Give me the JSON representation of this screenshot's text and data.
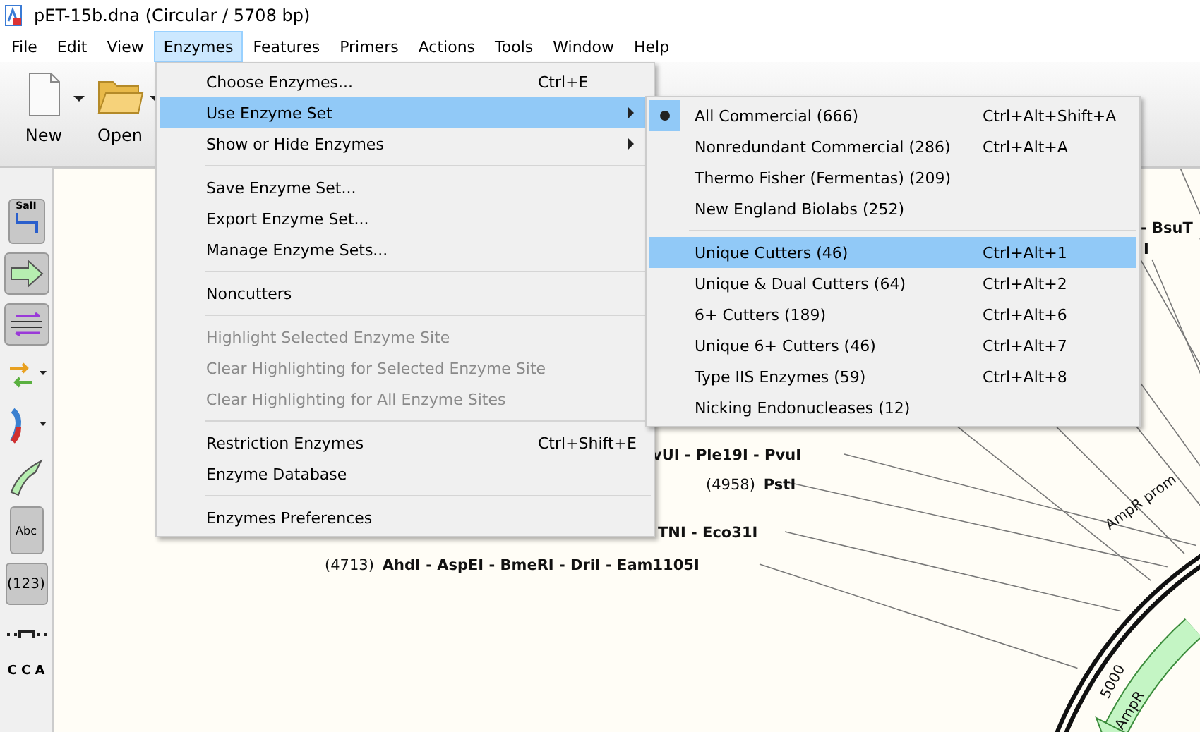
{
  "window": {
    "title": "pET-15b.dna  (Circular / 5708 bp)"
  },
  "menu_bar": [
    {
      "label": "File",
      "selected": false
    },
    {
      "label": "Edit",
      "selected": false
    },
    {
      "label": "View",
      "selected": false
    },
    {
      "label": "Enzymes",
      "selected": true
    },
    {
      "label": "Features",
      "selected": false
    },
    {
      "label": "Primers",
      "selected": false
    },
    {
      "label": "Actions",
      "selected": false
    },
    {
      "label": "Tools",
      "selected": false
    },
    {
      "label": "Window",
      "selected": false
    },
    {
      "label": "Help",
      "selected": false
    }
  ],
  "toolbar": [
    {
      "kind": "new",
      "label": "New"
    },
    {
      "kind": "open",
      "label": "Open"
    }
  ],
  "tool_strip": [
    {
      "kind": "sali",
      "label": "SalI"
    },
    {
      "kind": "arrow"
    },
    {
      "kind": "strands"
    },
    {
      "kind": "primers"
    },
    {
      "kind": "arc"
    },
    {
      "kind": "feature"
    },
    {
      "kind": "text",
      "label": "Abc"
    },
    {
      "kind": "numbers",
      "label": "(123)"
    },
    {
      "kind": "ruler"
    },
    {
      "kind": "sequence",
      "label": "C C A"
    }
  ],
  "enzymes_menu": [
    {
      "kind": "item",
      "label": "Choose Enzymes...",
      "shortcut": "Ctrl+E",
      "disabled": false,
      "selected": false
    },
    {
      "kind": "submenu",
      "label": "Use Enzyme Set",
      "disabled": false,
      "selected": true
    },
    {
      "kind": "submenu",
      "label": "Show or Hide Enzymes",
      "disabled": false,
      "selected": false
    },
    {
      "kind": "separator"
    },
    {
      "kind": "item",
      "label": "Save Enzyme Set...",
      "disabled": false,
      "selected": false
    },
    {
      "kind": "item",
      "label": "Export Enzyme Set...",
      "disabled": false,
      "selected": false
    },
    {
      "kind": "item",
      "label": "Manage Enzyme Sets...",
      "disabled": false,
      "selected": false
    },
    {
      "kind": "separator"
    },
    {
      "kind": "item",
      "label": "Noncutters",
      "disabled": false,
      "selected": false
    },
    {
      "kind": "separator"
    },
    {
      "kind": "item",
      "label": "Highlight Selected Enzyme Site",
      "disabled": true,
      "selected": false
    },
    {
      "kind": "item",
      "label": "Clear Highlighting for Selected Enzyme Site",
      "disabled": true,
      "selected": false
    },
    {
      "kind": "item",
      "label": "Clear Highlighting for All Enzyme Sites",
      "disabled": true,
      "selected": false
    },
    {
      "kind": "separator"
    },
    {
      "kind": "item",
      "label": "Restriction Enzymes",
      "shortcut": "Ctrl+Shift+E",
      "disabled": false,
      "selected": false
    },
    {
      "kind": "item",
      "label": "Enzyme Database",
      "disabled": false,
      "selected": false
    },
    {
      "kind": "separator"
    },
    {
      "kind": "item",
      "label": "Enzymes Preferences",
      "disabled": false,
      "selected": false
    }
  ],
  "enzyme_set_submenu": [
    {
      "kind": "item",
      "label": "All Commercial  (666)",
      "shortcut": "Ctrl+Alt+Shift+A",
      "checked": true,
      "selected": false
    },
    {
      "kind": "item",
      "label": "Nonredundant Commercial  (286)",
      "shortcut": "Ctrl+Alt+A",
      "checked": false,
      "selected": false
    },
    {
      "kind": "item",
      "label": "Thermo Fisher (Fermentas)  (209)",
      "checked": false,
      "selected": false
    },
    {
      "kind": "item",
      "label": "New England Biolabs  (252)",
      "checked": false,
      "selected": false
    },
    {
      "kind": "separator"
    },
    {
      "kind": "item",
      "label": "Unique Cutters  (46)",
      "shortcut": "Ctrl+Alt+1",
      "checked": false,
      "selected": true
    },
    {
      "kind": "item",
      "label": "Unique & Dual Cutters  (64)",
      "shortcut": "Ctrl+Alt+2",
      "checked": false,
      "selected": false
    },
    {
      "kind": "item",
      "label": "6+ Cutters  (189)",
      "shortcut": "Ctrl+Alt+6",
      "checked": false,
      "selected": false
    },
    {
      "kind": "item",
      "label": "Unique 6+ Cutters  (46)",
      "shortcut": "Ctrl+Alt+7",
      "checked": false,
      "selected": false
    },
    {
      "kind": "item",
      "label": "Type IIS Enzymes  (59)",
      "shortcut": "Ctrl+Alt+8",
      "checked": false,
      "selected": false
    },
    {
      "kind": "item",
      "label": "Nicking Endonucleases  (12)",
      "checked": false,
      "selected": false
    }
  ],
  "map": {
    "site_labels": [
      {
        "names": "- BsuT"
      },
      {
        "names": "I"
      },
      {
        "names": "vUI - Ple19I - PvuI"
      },
      {
        "position": "(4958)",
        "names": "PstI"
      },
      {
        "names": "TNI - Eco31I"
      },
      {
        "position": "(4713)",
        "names": "AhdI - AspEI - BmeRI - DriI - Eam1105I"
      }
    ],
    "tick_label": "5000",
    "features": [
      {
        "label": "AmpR prom"
      },
      {
        "label": "AmpR"
      }
    ]
  }
}
